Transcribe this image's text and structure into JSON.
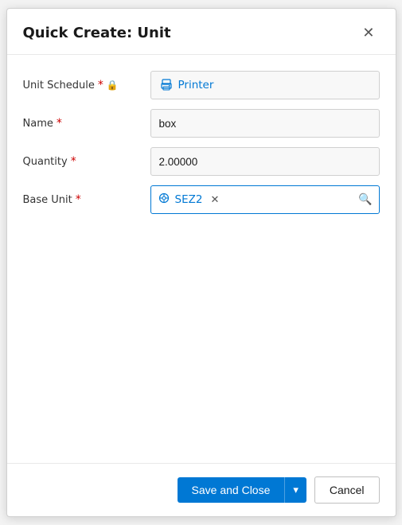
{
  "dialog": {
    "title": "Quick Create: Unit",
    "close_label": "×"
  },
  "fields": {
    "unit_schedule": {
      "label": "Unit Schedule",
      "required": true,
      "locked": true,
      "value": "Printer",
      "type": "link"
    },
    "name": {
      "label": "Name",
      "required": true,
      "value": "box",
      "type": "text"
    },
    "quantity": {
      "label": "Quantity",
      "required": true,
      "value": "2.00000",
      "type": "number"
    },
    "base_unit": {
      "label": "Base Unit",
      "required": true,
      "value": "SEZ2",
      "type": "lookup"
    }
  },
  "footer": {
    "save_and_close": "Save and Close",
    "chevron": "▾",
    "cancel": "Cancel"
  }
}
